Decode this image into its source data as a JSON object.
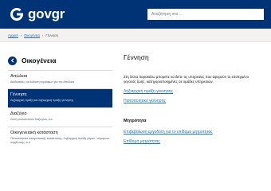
{
  "header": {
    "logo_text": "govgr",
    "search_placeholder": "Αναζήτηση στο ..."
  },
  "breadcrumb": {
    "home": "Αρχική",
    "separator": "›",
    "family": "Οικογένεια",
    "current": "Γέννηση"
  },
  "sidebar": {
    "title": "Οικογένεια",
    "items": [
      {
        "label": "Απώλεια",
        "desc": "Διαδικασίες για έκδοση εγγράφων για την Απώλεια"
      },
      {
        "label": "Γέννηση",
        "desc": "Ληξιαρχική πράξη και ληξιαρχική πράξη γέννησης",
        "active": true
      },
      {
        "label": "Διαζύγιο",
        "desc": "Λύση συναινετικού διαζυγίου, κ.ά."
      },
      {
        "label": "Οικογενειακή κατάσταση",
        "desc": "Πιστοποιητικό οικογενειακής κατάστασης, Ληξιαρχική πράξη γάμου / σύμφωνο συμβίωσης, κ.ά."
      }
    ]
  },
  "main": {
    "title": "Γέννηση",
    "intro_line1": "Στη λίστα παρακάτω μπορείτε να δείτε τις υπηρεσίες που αφορούν το επιλεγμένο",
    "intro_line2": "γεγονός ζωής, κατηγοριοποιημένες σε ομάδες υπηρεσιών.",
    "links": [
      "Ληξιαρχική πράξη γέννησης",
      "Πιστοποιητικό γέννησης"
    ],
    "section": "Μητρότητα",
    "section_links": [
      "Επιβεβαίωση εργοδότη για το επίδομα μητρότητας",
      "Επίδομα μητρότητας"
    ]
  },
  "colors": {
    "brand": "#003375",
    "link": "#1d70b8",
    "breadcrumb_bg": "#f3f2f1"
  },
  "icons": [
    "govgr-logo-icon",
    "back-arrow-icon"
  ]
}
